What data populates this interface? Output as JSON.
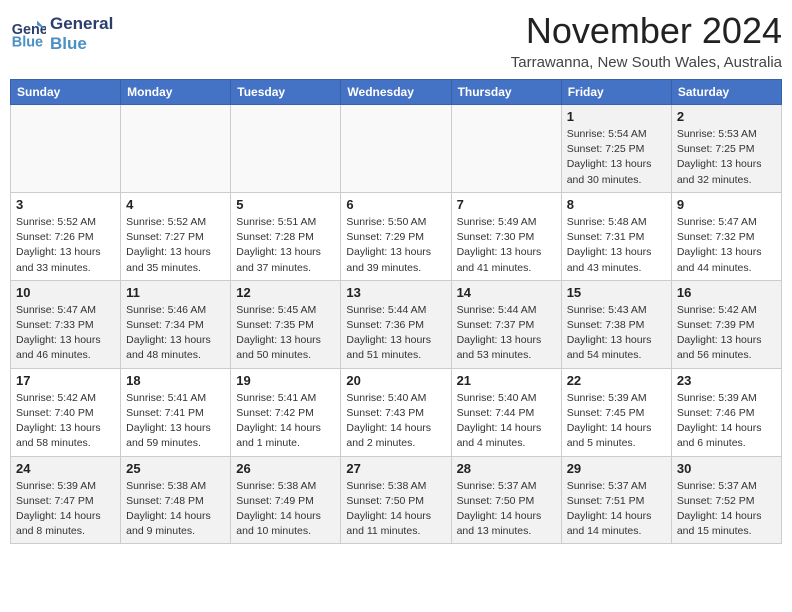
{
  "header": {
    "logo_line1": "General",
    "logo_line2": "Blue",
    "month": "November 2024",
    "location": "Tarrawanna, New South Wales, Australia"
  },
  "weekdays": [
    "Sunday",
    "Monday",
    "Tuesday",
    "Wednesday",
    "Thursday",
    "Friday",
    "Saturday"
  ],
  "weeks": [
    [
      {
        "day": "",
        "detail": ""
      },
      {
        "day": "",
        "detail": ""
      },
      {
        "day": "",
        "detail": ""
      },
      {
        "day": "",
        "detail": ""
      },
      {
        "day": "",
        "detail": ""
      },
      {
        "day": "1",
        "detail": "Sunrise: 5:54 AM\nSunset: 7:25 PM\nDaylight: 13 hours\nand 30 minutes."
      },
      {
        "day": "2",
        "detail": "Sunrise: 5:53 AM\nSunset: 7:25 PM\nDaylight: 13 hours\nand 32 minutes."
      }
    ],
    [
      {
        "day": "3",
        "detail": "Sunrise: 5:52 AM\nSunset: 7:26 PM\nDaylight: 13 hours\nand 33 minutes."
      },
      {
        "day": "4",
        "detail": "Sunrise: 5:52 AM\nSunset: 7:27 PM\nDaylight: 13 hours\nand 35 minutes."
      },
      {
        "day": "5",
        "detail": "Sunrise: 5:51 AM\nSunset: 7:28 PM\nDaylight: 13 hours\nand 37 minutes."
      },
      {
        "day": "6",
        "detail": "Sunrise: 5:50 AM\nSunset: 7:29 PM\nDaylight: 13 hours\nand 39 minutes."
      },
      {
        "day": "7",
        "detail": "Sunrise: 5:49 AM\nSunset: 7:30 PM\nDaylight: 13 hours\nand 41 minutes."
      },
      {
        "day": "8",
        "detail": "Sunrise: 5:48 AM\nSunset: 7:31 PM\nDaylight: 13 hours\nand 43 minutes."
      },
      {
        "day": "9",
        "detail": "Sunrise: 5:47 AM\nSunset: 7:32 PM\nDaylight: 13 hours\nand 44 minutes."
      }
    ],
    [
      {
        "day": "10",
        "detail": "Sunrise: 5:47 AM\nSunset: 7:33 PM\nDaylight: 13 hours\nand 46 minutes."
      },
      {
        "day": "11",
        "detail": "Sunrise: 5:46 AM\nSunset: 7:34 PM\nDaylight: 13 hours\nand 48 minutes."
      },
      {
        "day": "12",
        "detail": "Sunrise: 5:45 AM\nSunset: 7:35 PM\nDaylight: 13 hours\nand 50 minutes."
      },
      {
        "day": "13",
        "detail": "Sunrise: 5:44 AM\nSunset: 7:36 PM\nDaylight: 13 hours\nand 51 minutes."
      },
      {
        "day": "14",
        "detail": "Sunrise: 5:44 AM\nSunset: 7:37 PM\nDaylight: 13 hours\nand 53 minutes."
      },
      {
        "day": "15",
        "detail": "Sunrise: 5:43 AM\nSunset: 7:38 PM\nDaylight: 13 hours\nand 54 minutes."
      },
      {
        "day": "16",
        "detail": "Sunrise: 5:42 AM\nSunset: 7:39 PM\nDaylight: 13 hours\nand 56 minutes."
      }
    ],
    [
      {
        "day": "17",
        "detail": "Sunrise: 5:42 AM\nSunset: 7:40 PM\nDaylight: 13 hours\nand 58 minutes."
      },
      {
        "day": "18",
        "detail": "Sunrise: 5:41 AM\nSunset: 7:41 PM\nDaylight: 13 hours\nand 59 minutes."
      },
      {
        "day": "19",
        "detail": "Sunrise: 5:41 AM\nSunset: 7:42 PM\nDaylight: 14 hours\nand 1 minute."
      },
      {
        "day": "20",
        "detail": "Sunrise: 5:40 AM\nSunset: 7:43 PM\nDaylight: 14 hours\nand 2 minutes."
      },
      {
        "day": "21",
        "detail": "Sunrise: 5:40 AM\nSunset: 7:44 PM\nDaylight: 14 hours\nand 4 minutes."
      },
      {
        "day": "22",
        "detail": "Sunrise: 5:39 AM\nSunset: 7:45 PM\nDaylight: 14 hours\nand 5 minutes."
      },
      {
        "day": "23",
        "detail": "Sunrise: 5:39 AM\nSunset: 7:46 PM\nDaylight: 14 hours\nand 6 minutes."
      }
    ],
    [
      {
        "day": "24",
        "detail": "Sunrise: 5:39 AM\nSunset: 7:47 PM\nDaylight: 14 hours\nand 8 minutes."
      },
      {
        "day": "25",
        "detail": "Sunrise: 5:38 AM\nSunset: 7:48 PM\nDaylight: 14 hours\nand 9 minutes."
      },
      {
        "day": "26",
        "detail": "Sunrise: 5:38 AM\nSunset: 7:49 PM\nDaylight: 14 hours\nand 10 minutes."
      },
      {
        "day": "27",
        "detail": "Sunrise: 5:38 AM\nSunset: 7:50 PM\nDaylight: 14 hours\nand 11 minutes."
      },
      {
        "day": "28",
        "detail": "Sunrise: 5:37 AM\nSunset: 7:50 PM\nDaylight: 14 hours\nand 13 minutes."
      },
      {
        "day": "29",
        "detail": "Sunrise: 5:37 AM\nSunset: 7:51 PM\nDaylight: 14 hours\nand 14 minutes."
      },
      {
        "day": "30",
        "detail": "Sunrise: 5:37 AM\nSunset: 7:52 PM\nDaylight: 14 hours\nand 15 minutes."
      }
    ]
  ]
}
